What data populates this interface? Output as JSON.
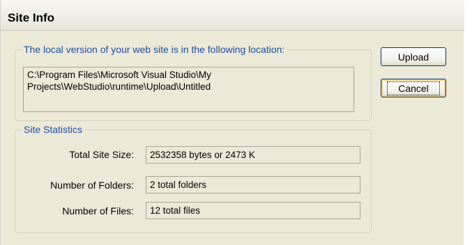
{
  "dialog": {
    "title": "Site Info"
  },
  "location_group": {
    "legend": "The local version of your web site is in the following location:",
    "path_line1": "C:\\Program Files\\Microsoft Visual Studio\\My",
    "path_line2": "Projects\\WebStudio\\runtime\\Upload\\Untitled"
  },
  "stats_group": {
    "legend": "Site Statistics",
    "rows": [
      {
        "label": "Total Site Size:",
        "value": "2532358 bytes or 2473 K"
      },
      {
        "label": "Number of Folders:",
        "value": "2 total folders"
      },
      {
        "label": "Number of Files:",
        "value": "12 total files"
      }
    ]
  },
  "buttons": {
    "upload_label": "Upload",
    "cancel_label": "Cancel"
  }
}
